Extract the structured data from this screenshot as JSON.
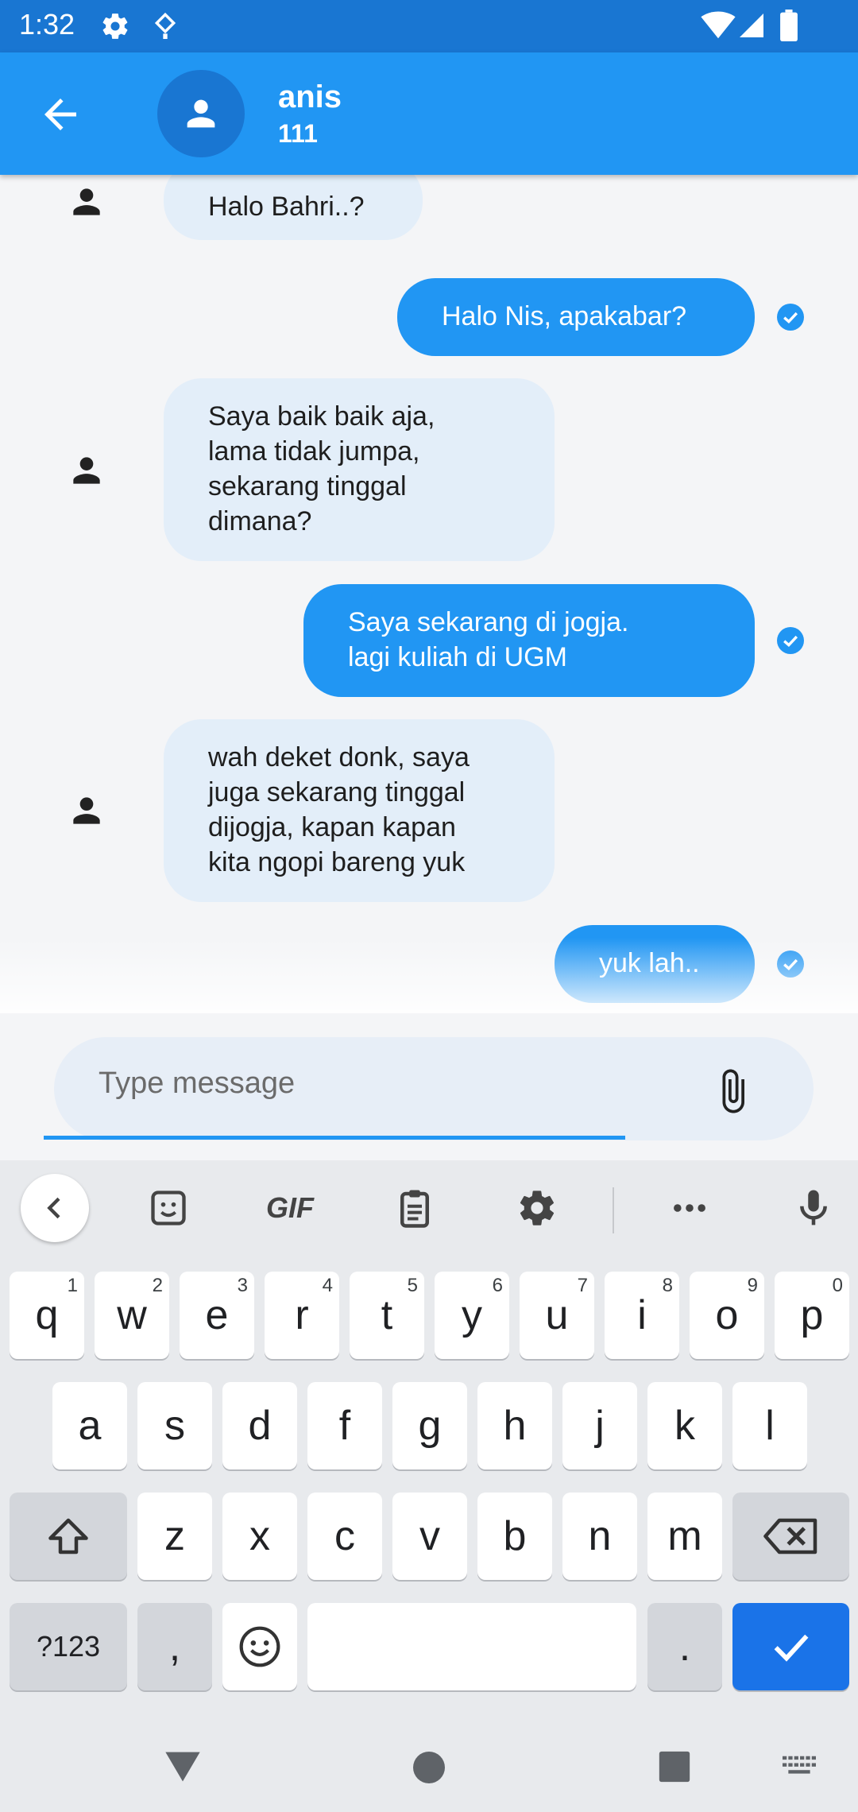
{
  "status_bar": {
    "time": "1:32"
  },
  "header": {
    "contact_name": "anis",
    "contact_subtitle": "111"
  },
  "messages": [
    {
      "direction": "in",
      "lines": [
        "Halo Bahri..?"
      ]
    },
    {
      "direction": "out",
      "lines": [
        "Halo Nis, apakabar?"
      ]
    },
    {
      "direction": "in",
      "lines": [
        "Saya baik baik aja,",
        "lama tidak jumpa,",
        "sekarang tinggal",
        "dimana?"
      ]
    },
    {
      "direction": "out",
      "lines": [
        "Saya sekarang di jogja.",
        "lagi kuliah di UGM"
      ]
    },
    {
      "direction": "in",
      "lines": [
        "wah deket donk, saya",
        "juga sekarang tinggal",
        "dijogja, kapan kapan",
        "kita ngopi bareng yuk"
      ]
    },
    {
      "direction": "out",
      "lines": [
        "yuk lah.."
      ]
    }
  ],
  "composer": {
    "placeholder": "Type message",
    "value": ""
  },
  "keyboard": {
    "toolbar": {
      "gif_label": "GIF"
    },
    "row1": [
      {
        "key": "q",
        "hint": "1"
      },
      {
        "key": "w",
        "hint": "2"
      },
      {
        "key": "e",
        "hint": "3"
      },
      {
        "key": "r",
        "hint": "4"
      },
      {
        "key": "t",
        "hint": "5"
      },
      {
        "key": "y",
        "hint": "6"
      },
      {
        "key": "u",
        "hint": "7"
      },
      {
        "key": "i",
        "hint": "8"
      },
      {
        "key": "o",
        "hint": "9"
      },
      {
        "key": "p",
        "hint": "0"
      }
    ],
    "row2": [
      "a",
      "s",
      "d",
      "f",
      "g",
      "h",
      "j",
      "k",
      "l"
    ],
    "row3": [
      "z",
      "x",
      "c",
      "v",
      "b",
      "n",
      "m"
    ],
    "symbols_label": "?123",
    "comma": ",",
    "period": "."
  },
  "colors": {
    "status_bar": "#1976d2",
    "app_bar": "#2196f3",
    "incoming_bubble": "#e3eef9",
    "outgoing_bubble": "#2196f3",
    "enter_key": "#1a73e8"
  }
}
